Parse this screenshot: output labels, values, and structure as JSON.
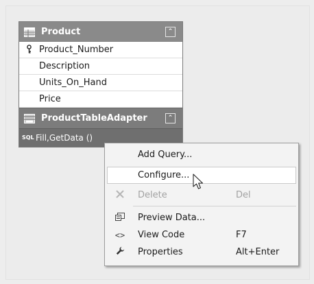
{
  "table": {
    "title": "Product",
    "columns": [
      {
        "name": "Product_Number",
        "is_key": true
      },
      {
        "name": "Description",
        "is_key": false
      },
      {
        "name": "Units_On_Hand",
        "is_key": false
      },
      {
        "name": "Price",
        "is_key": false
      }
    ],
    "key_icon": "key-icon",
    "collapse_glyph": "⌃"
  },
  "adapter": {
    "title": "ProductTableAdapter",
    "query": "Fill,GetData ()",
    "sql_icon_text": "SQL"
  },
  "context_menu": {
    "items": [
      {
        "label": "Add Query...",
        "shortcut": "",
        "icon": "",
        "enabled": true
      },
      {
        "label": "Configure...",
        "shortcut": "",
        "icon": "",
        "enabled": true,
        "highlighted": true
      },
      {
        "label": "Delete",
        "shortcut": "Del",
        "icon": "delete-x-icon",
        "enabled": false
      },
      {
        "label": "Preview Data...",
        "shortcut": "",
        "icon": "preview-data-icon",
        "enabled": true
      },
      {
        "label": "View Code",
        "shortcut": "F7",
        "icon": "view-code-icon",
        "enabled": true
      },
      {
        "label": "Properties",
        "shortcut": "Alt+Enter",
        "icon": "wrench-icon",
        "enabled": true
      }
    ]
  },
  "colors": {
    "header_bg": "#8a8a8a",
    "adapter_bg": "#7c7c7c",
    "query_bg": "#6f6f6f",
    "menu_bg": "#f3f3f3"
  }
}
